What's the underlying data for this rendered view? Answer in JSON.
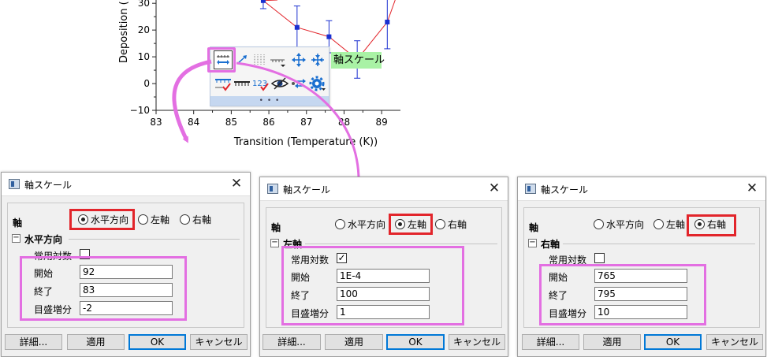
{
  "chart": {
    "ylabel": "Deposition (",
    "xlabel": "Transition (Temperature (K))",
    "x_ticks": [
      "83",
      "84",
      "85",
      "86",
      "87",
      "88",
      "89"
    ],
    "y_ticks": [
      "30",
      "20",
      "10",
      "0",
      "−10"
    ]
  },
  "chart_data": {
    "type": "scatter",
    "xlabel": "Transition (Temperature (K))",
    "ylabel": "Deposition (",
    "xlim": [
      83,
      89.5
    ],
    "ylim": [
      -10,
      33
    ],
    "grid": false,
    "points": [
      {
        "x": 85.85,
        "y": 31,
        "err": 3
      },
      {
        "x": 86.75,
        "y": 21,
        "err": 8
      },
      {
        "x": 87.6,
        "y": 17.5,
        "err": 6
      },
      {
        "x": 88.35,
        "y": 9,
        "err": 7
      },
      {
        "x": 89.15,
        "y": 23,
        "err": 10
      }
    ],
    "colors": {
      "marker": "#1a2fd0",
      "line": "#e2252b"
    }
  },
  "mini_toolbar": {
    "tooltip": "軸スケール",
    "footer": "• • •",
    "icons_row1": [
      "axis-scale-icon",
      "rescale-arrow-icon",
      "grid-lines-icon",
      "tick-style-icon",
      "axis-expand-icon",
      "axis-shrink-icon"
    ],
    "icons_row2": [
      "ruler-icon",
      "tick-check-icon",
      "tick-label-number-icon",
      "show-hide-eye-icon",
      "axis-swap-icon",
      "axis-settings-gear-icon"
    ]
  },
  "dialogs": [
    {
      "title": "軸スケール",
      "axis_label": "軸",
      "options": [
        "水平方向",
        "左軸",
        "右軸"
      ],
      "selected": 0,
      "section": "水平方向",
      "log_label": "常用対数",
      "log_checked": false,
      "fields": [
        {
          "label": "開始",
          "value": "92"
        },
        {
          "label": "終了",
          "value": "83"
        },
        {
          "label": "目盛増分",
          "value": "-2"
        }
      ],
      "buttons": [
        "詳細...",
        "適用",
        "OK",
        "キャンセル"
      ]
    },
    {
      "title": "軸スケール",
      "axis_label": "軸",
      "options": [
        "水平方向",
        "左軸",
        "右軸"
      ],
      "selected": 1,
      "section": "左軸",
      "log_label": "常用対数",
      "log_checked": true,
      "fields": [
        {
          "label": "開始",
          "value": "1E-4"
        },
        {
          "label": "終了",
          "value": "100"
        },
        {
          "label": "目盛増分",
          "value": "1"
        }
      ],
      "buttons": [
        "詳細...",
        "適用",
        "OK",
        "キャンセル"
      ]
    },
    {
      "title": "軸スケール",
      "axis_label": "軸",
      "options": [
        "水平方向",
        "左軸",
        "右軸"
      ],
      "selected": 2,
      "section": "右軸",
      "log_label": "常用対数",
      "log_checked": false,
      "fields": [
        {
          "label": "開始",
          "value": "765"
        },
        {
          "label": "終了",
          "value": "795"
        },
        {
          "label": "目盛増分",
          "value": "10"
        }
      ],
      "buttons": [
        "詳細...",
        "適用",
        "OK",
        "キャンセル"
      ]
    }
  ],
  "colors": {
    "highlight_red": "#e2252b",
    "highlight_magenta": "#e36fe2",
    "tooltip_bg": "#a9f2a5",
    "ok_border": "#0078d7"
  }
}
